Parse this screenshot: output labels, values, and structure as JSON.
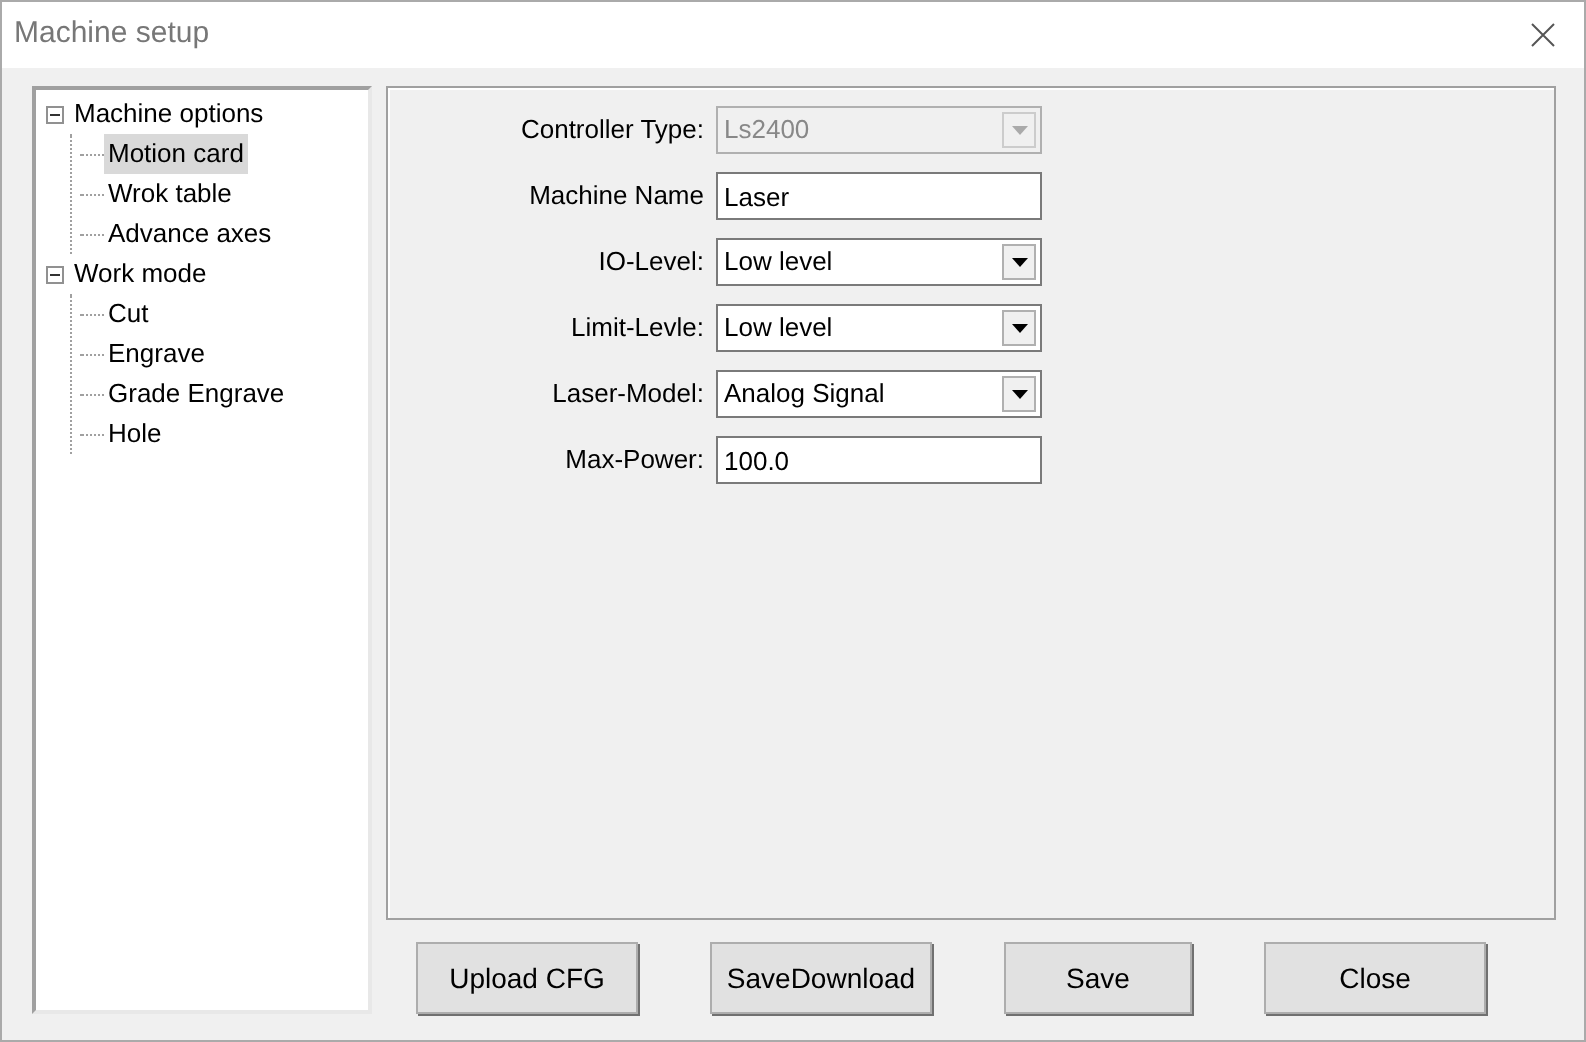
{
  "window": {
    "title": "Machine setup"
  },
  "tree": [
    {
      "label": "Machine options",
      "expanded": true,
      "selected": false,
      "children": [
        {
          "label": "Motion card",
          "selected": true
        },
        {
          "label": "Wrok table",
          "selected": false
        },
        {
          "label": "Advance axes",
          "selected": false
        }
      ]
    },
    {
      "label": "Work mode",
      "expanded": true,
      "selected": false,
      "children": [
        {
          "label": "Cut",
          "selected": false
        },
        {
          "label": "Engrave",
          "selected": false
        },
        {
          "label": "Grade Engrave",
          "selected": false
        },
        {
          "label": "Hole",
          "selected": false
        }
      ]
    }
  ],
  "fields": [
    {
      "kind": "combo",
      "label": "Controller Type:",
      "value": "Ls2400",
      "disabled": true
    },
    {
      "kind": "text",
      "label": "Machine Name",
      "value": "Laser",
      "disabled": false
    },
    {
      "kind": "combo",
      "label": "IO-Level:",
      "value": "Low level",
      "disabled": false
    },
    {
      "kind": "combo",
      "label": "Limit-Levle:",
      "value": "Low level",
      "disabled": false
    },
    {
      "kind": "combo",
      "label": "Laser-Model:",
      "value": "Analog Signal",
      "disabled": false
    },
    {
      "kind": "text",
      "label": "Max-Power:",
      "value": "100.0",
      "disabled": false
    }
  ],
  "buttons": [
    "Upload CFG",
    "SaveDownload",
    "Save",
    "Close"
  ]
}
